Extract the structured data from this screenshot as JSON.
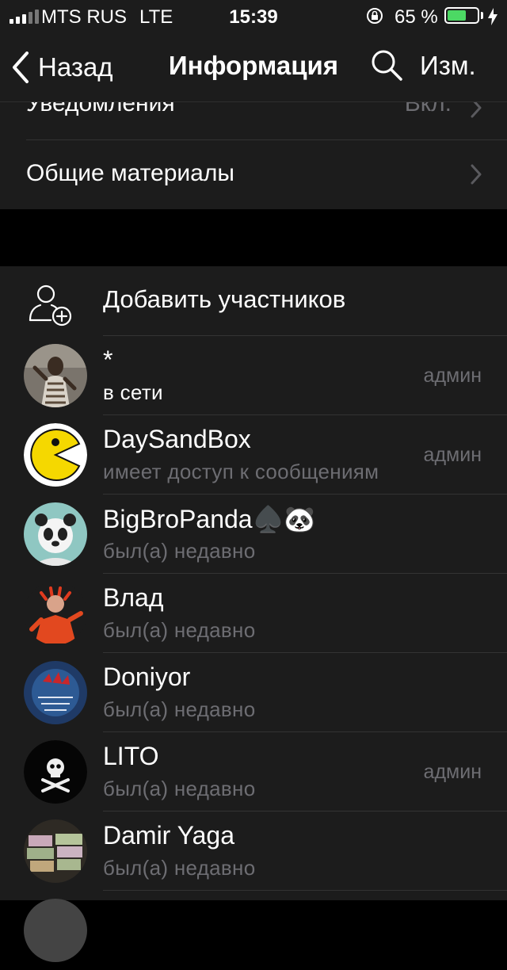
{
  "status_bar": {
    "carrier": "MTS RUS",
    "network": "LTE",
    "time": "15:39",
    "battery_percent": "65 %",
    "battery_level": 0.65,
    "battery_color": "#4cd964"
  },
  "nav": {
    "back_label": "Назад",
    "title": "Информация",
    "edit_label": "Изм."
  },
  "settings": {
    "notifications_label": "Уведомления",
    "notifications_value": "Вкл.",
    "shared_media_label": "Общие материалы"
  },
  "members": {
    "add_label": "Добавить участников",
    "list": [
      {
        "name": "*",
        "status": "в сети",
        "role": "админ",
        "avatar": "photo-person"
      },
      {
        "name": "DaySandBox",
        "status": "имеет доступ к сообщениям",
        "role": "админ",
        "avatar": "pacman"
      },
      {
        "name": "BigBroPanda♠️🐼",
        "status": "был(а) недавно",
        "role": "",
        "avatar": "panda"
      },
      {
        "name": "Влад",
        "status": "был(а) недавно",
        "role": "",
        "avatar": "red-figure"
      },
      {
        "name": "Doniyor",
        "status": "был(а) недавно",
        "role": "",
        "avatar": "blue-art"
      },
      {
        "name": "LITO",
        "status": "был(а) недавно",
        "role": "админ",
        "avatar": "skull"
      },
      {
        "name": "Damir Yaga",
        "status": "был(а) недавно",
        "role": "",
        "avatar": "money"
      }
    ]
  }
}
